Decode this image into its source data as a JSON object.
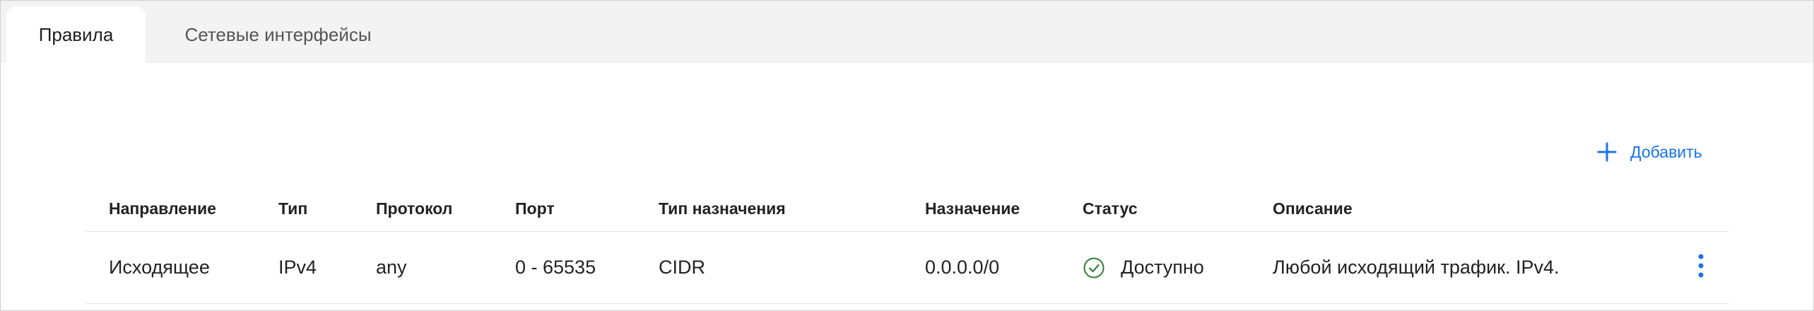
{
  "tabs": [
    {
      "label": "Правила",
      "active": true
    },
    {
      "label": "Сетевые интерфейсы",
      "active": false
    }
  ],
  "toolbar": {
    "add_label": "Добавить",
    "add_icon": "plus-icon",
    "accent": "#1a73e8"
  },
  "table": {
    "columns": [
      "Направление",
      "Тип",
      "Протокол",
      "Порт",
      "Тип назначения",
      "Назначение",
      "Статус",
      "Описание"
    ],
    "rows": [
      {
        "direction": "Исходящее",
        "type": "IPv4",
        "protocol": "any",
        "port": "0 - 65535",
        "dest_type": "CIDR",
        "destination": "0.0.0.0/0",
        "status": "Доступно",
        "status_icon": "check-circle-icon",
        "status_color": "#2e7d32",
        "description": "Любой исходящий трафик. IPv4.",
        "menu_icon": "more-vertical-icon"
      }
    ]
  }
}
